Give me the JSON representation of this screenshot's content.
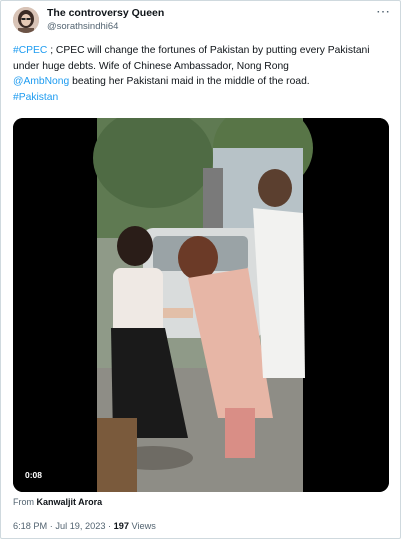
{
  "author": {
    "name": "The controversy Queen",
    "handle": "@sorathsindhi64"
  },
  "more_icon": "more-horizontal-icon",
  "tweet": {
    "hashtag1": "#CPEC",
    "text1": " ; CPEC will change the fortunes of Pakistan by putting every Pakistani under huge debts.   Wife of Chinese Ambassador, Nong Rong ",
    "mention": "@AmbNong",
    "text2": " beating her Pakistani maid in the middle of the road.",
    "hashtag2": "#Pakistan"
  },
  "video": {
    "duration": "0:08"
  },
  "source": {
    "prefix": "From ",
    "name": "Kanwaljit Arora"
  },
  "meta": {
    "time": "6:18 PM",
    "sep1": " · ",
    "date": "Jul 19, 2023",
    "sep2": " · ",
    "views_count": "197",
    "views_label": " Views"
  },
  "colors": {
    "link": "#1d9bf0",
    "secondary_text": "#536471",
    "border": "#cfd9de"
  }
}
